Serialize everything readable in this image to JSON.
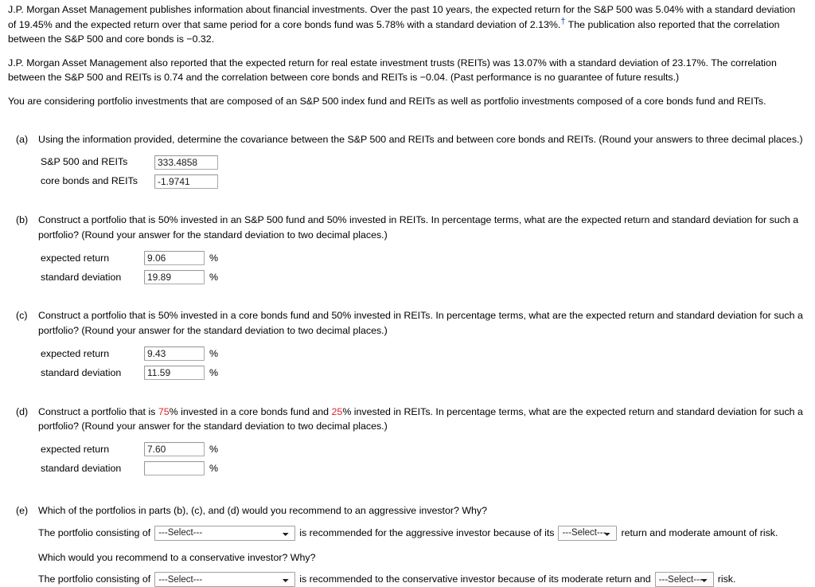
{
  "intro": {
    "paragraph1_part1": "J.P. Morgan Asset Management publishes information about financial investments. Over the past 10 years, the expected return for the S&P 500 was 5.04% with a standard deviation of 19.45% and the expected return over that same period for a core bonds fund was 5.78% with a standard deviation of 2.13%.",
    "footnote_marker": "†",
    "paragraph1_part2": " The publication also reported that the correlation between the S&P 500 and core bonds is −0.32.",
    "paragraph2": "J.P. Morgan Asset Management also reported that the expected return for real estate investment trusts (REITs) was 13.07% with a standard deviation of 23.17%. The correlation between the S&P 500 and REITs is 0.74 and the correlation between core bonds and REITs is −0.04. (Past performance is no guarantee of future results.)",
    "paragraph3": "You are considering portfolio investments that are composed of an S&P 500 index fund and REITs as well as portfolio investments composed of a core bonds fund and REITs."
  },
  "parts": {
    "a": {
      "letter": "(a)",
      "prompt": "Using the information provided, determine the covariance between the S&P 500 and REITs and between core bonds and REITs. (Round your answers to three decimal places.)",
      "rows": [
        {
          "label": "S&P 500 and REITs",
          "value": "333.4858"
        },
        {
          "label": "core bonds and REITs",
          "value": "-1.9741"
        }
      ]
    },
    "b": {
      "letter": "(b)",
      "prompt_1": "Construct a portfolio that is 50% invested in an S&P 500 fund and 50% invested in REITs. In percentage terms, what are the expected return and standard deviation for such a portfolio? (Round your answer for the standard deviation to two decimal places.)",
      "rows": [
        {
          "label": "expected return",
          "value": "9.06",
          "unit": "%"
        },
        {
          "label": "standard deviation",
          "value": "19.89",
          "unit": "%"
        }
      ]
    },
    "c": {
      "letter": "(c)",
      "prompt_1": "Construct a portfolio that is 50% invested in a core bonds fund and 50% invested in REITs. In percentage terms, what are the expected return and standard deviation for such a portfolio? (Round your answer for the standard deviation to two decimal places.)",
      "rows": [
        {
          "label": "expected return",
          "value": "9.43",
          "unit": "%"
        },
        {
          "label": "standard deviation",
          "value": "11.59",
          "unit": "%"
        }
      ]
    },
    "d": {
      "letter": "(d)",
      "prompt_pre": "Construct a portfolio that is ",
      "weight_bonds": "75",
      "prompt_mid": "% invested in a core bonds fund and ",
      "weight_reits": "25",
      "prompt_post": "% invested in REITs. In percentage terms, what are the expected return and standard deviation for such a portfolio? (Round your answer for the standard deviation to two decimal places.)",
      "rows": [
        {
          "label": "expected return",
          "value": "7.60",
          "unit": "%"
        },
        {
          "label": "standard deviation",
          "value": "",
          "unit": "%"
        }
      ]
    },
    "e": {
      "letter": "(e)",
      "question_aggressive": "Which of the portfolios in parts (b), (c), and (d) would you recommend to an aggressive investor? Why?",
      "agg_prefix": "The portfolio consisting of",
      "agg_mid": "is recommended for the aggressive investor because of its",
      "agg_suffix": "return and moderate amount of risk.",
      "question_conservative": "Which would you recommend to a conservative investor? Why?",
      "cons_prefix": "The portfolio consisting of",
      "cons_mid": "is recommended to the conservative investor because of its moderate return and",
      "cons_suffix": "risk.",
      "select_placeholder": "---Select---"
    }
  },
  "colors": {
    "highlight": "#e0202a",
    "footnote_link": "#2b45c0"
  }
}
